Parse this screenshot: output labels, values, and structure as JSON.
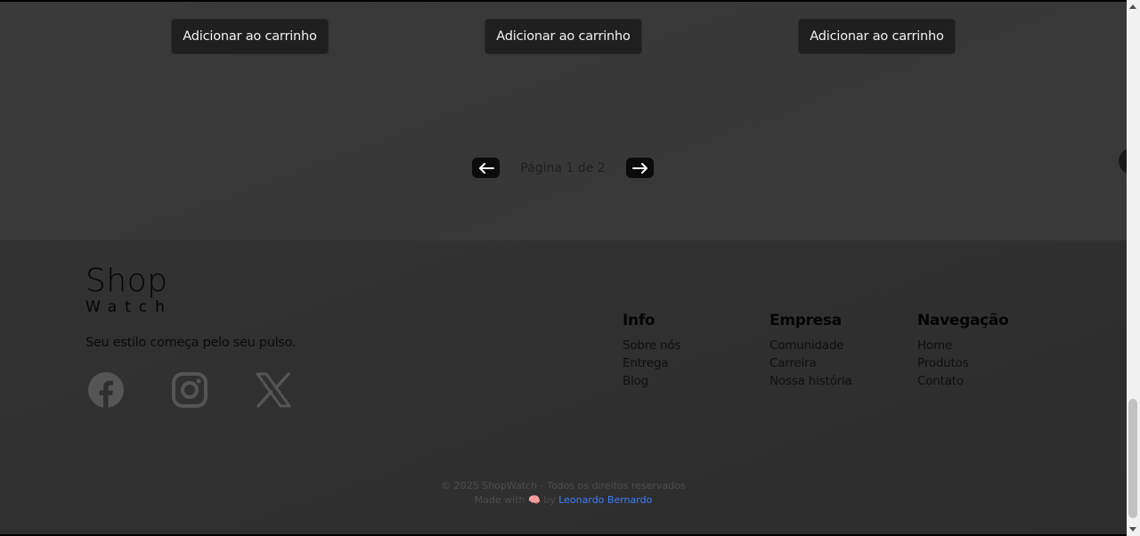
{
  "products": {
    "cart_buttons": [
      "Adicionar ao carrinho",
      "Adicionar ao carrinho",
      "Adicionar ao carrinho"
    ]
  },
  "pagination": {
    "prev_icon": "arrow-left-icon",
    "label": "Página 1 de 2",
    "next_icon": "arrow-right-icon"
  },
  "footer": {
    "logo_top": "Shop",
    "logo_bottom": "Watch",
    "tagline": "Seu estilo começa pelo seu pulso.",
    "socials": [
      "facebook-icon",
      "instagram-icon",
      "x-icon"
    ],
    "columns": [
      {
        "title": "Info",
        "links": [
          "Sobre nós",
          "Entrega",
          "Blog"
        ]
      },
      {
        "title": "Empresa",
        "links": [
          "Comunidade",
          "Carreira",
          "Nossa história"
        ]
      },
      {
        "title": "Navegação",
        "links": [
          "Home",
          "Produtos",
          "Contato"
        ]
      }
    ],
    "copyright": "© 2025 ShopWatch - Todos os direitos reservados",
    "made_with": "Made with",
    "made_icon": "🧠",
    "by": "by",
    "author": "Leonardo Bernardo"
  },
  "colors": {
    "page_bg": "#393939",
    "footer_bg": "#2f2f2f",
    "button_bg": "#1f1f1f",
    "link_accent": "#3d7dff",
    "icon_gray": "#555555"
  }
}
